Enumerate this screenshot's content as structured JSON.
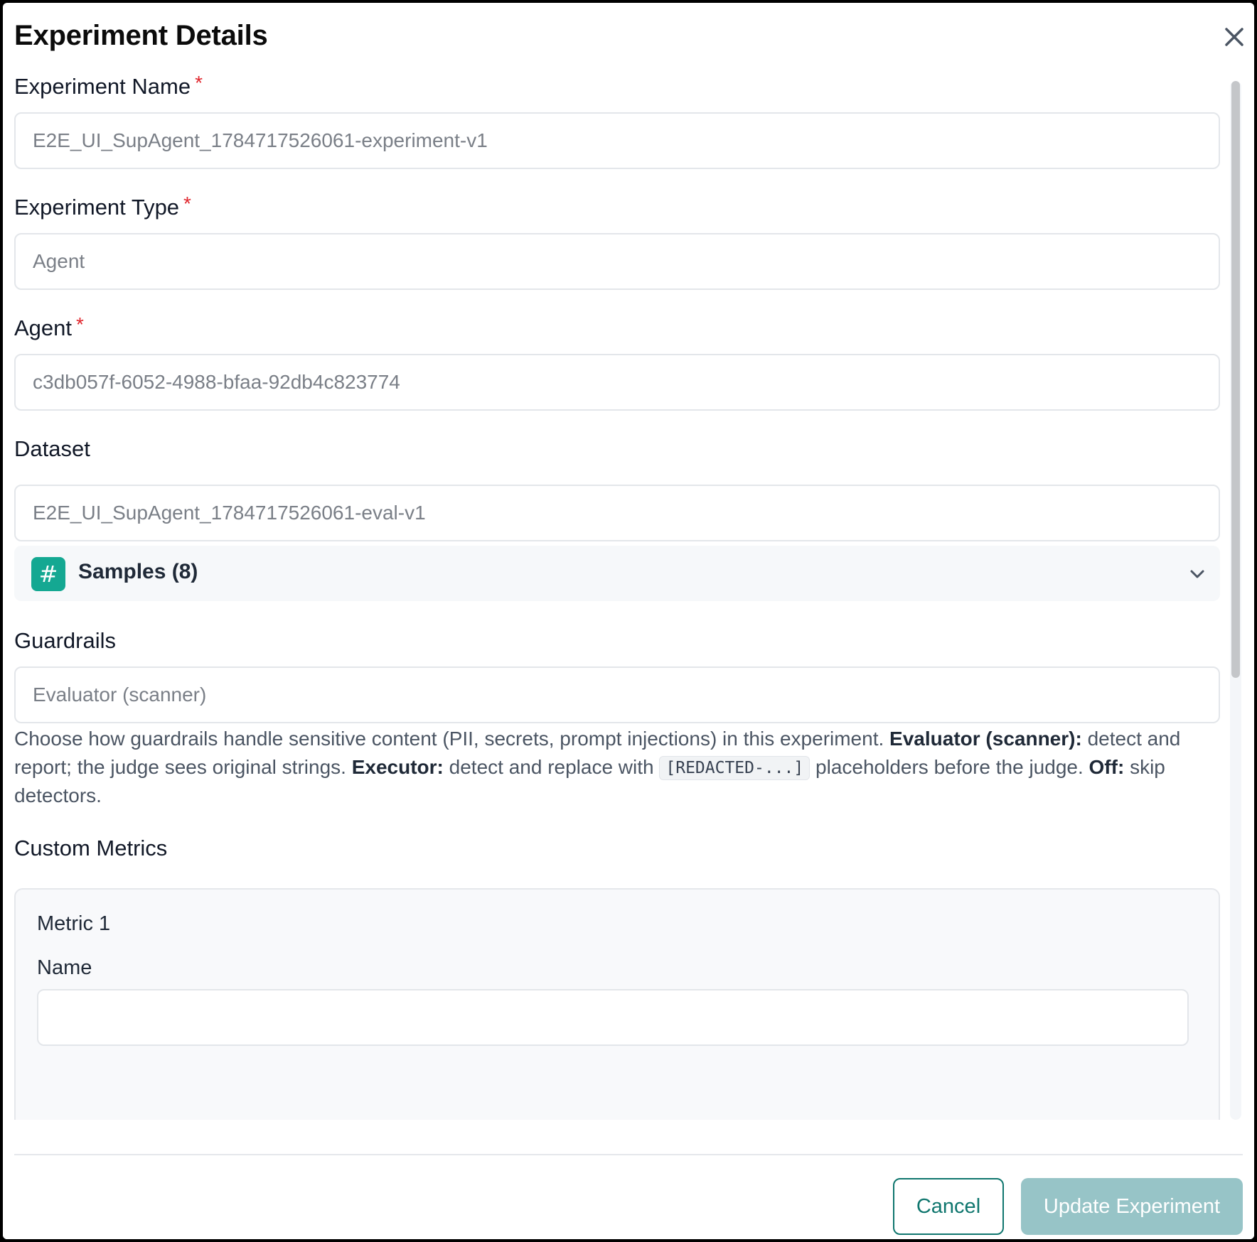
{
  "dialog": {
    "title": "Experiment Details",
    "close_icon": "close-icon"
  },
  "fields": {
    "experiment_name": {
      "label": "Experiment Name",
      "required_marker": "*",
      "value": "E2E_UI_SupAgent_1784717526061-experiment-v1"
    },
    "experiment_type": {
      "label": "Experiment Type",
      "required_marker": "*",
      "value": "Agent"
    },
    "agent": {
      "label": "Agent",
      "required_marker": "*",
      "value": "c3db057f-6052-4988-bfaa-92db4c823774"
    },
    "dataset": {
      "label": "Dataset",
      "value": "E2E_UI_SupAgent_1784717526061-eval-v1",
      "samples": {
        "icon_glyph": "#",
        "label": "Samples (8)"
      }
    },
    "guardrails": {
      "label": "Guardrails",
      "value": "Evaluator (scanner)",
      "help": {
        "part1": "Choose how guardrails handle sensitive content (PII, secrets, prompt injections) in this experiment. ",
        "evaluator_term": "Evaluator (scanner):",
        "part2": " detect and report; the judge sees original strings. ",
        "executor_term": "Executor:",
        "part3": " detect and replace with ",
        "code": "[REDACTED-...]",
        "part4": " placeholders before the judge. ",
        "off_term": "Off:",
        "part5": " skip detectors."
      }
    }
  },
  "custom_metrics": {
    "label": "Custom Metrics",
    "metrics": [
      {
        "title": "Metric 1",
        "name_label": "Name"
      }
    ]
  },
  "footer": {
    "cancel_label": "Cancel",
    "update_label": "Update Experiment"
  },
  "colors": {
    "accent": "#0f766e",
    "required": "#e0262d",
    "badge": "#14a892",
    "disabled_primary": "#97c4c7"
  }
}
